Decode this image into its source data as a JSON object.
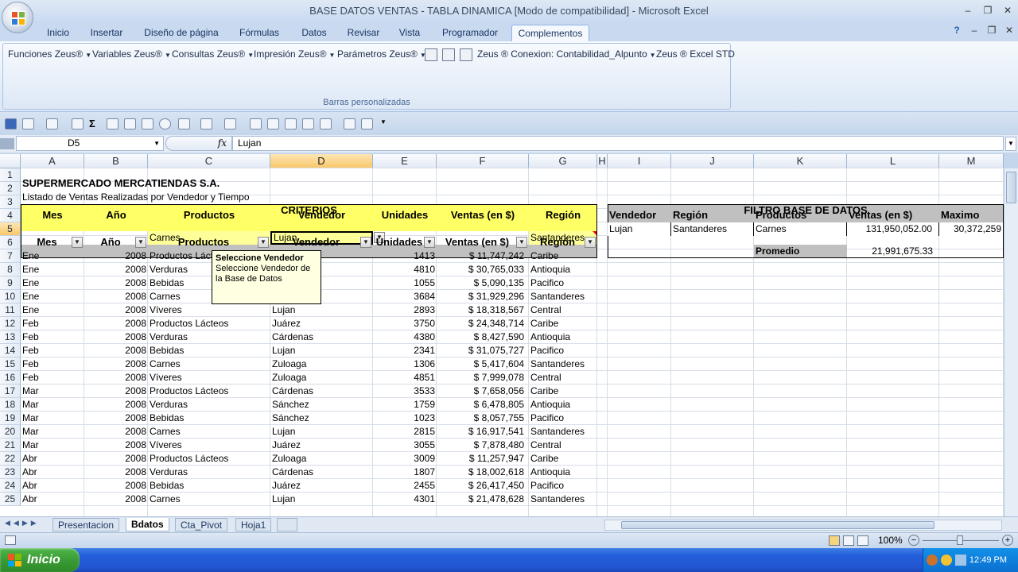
{
  "window": {
    "title": "BASE DATOS VENTAS - TABLA DINAMICA  [Modo de compatibilidad] - Microsoft Excel",
    "min": "–",
    "max": "❐",
    "close": "✕"
  },
  "tabs": [
    "Inicio",
    "Insertar",
    "Diseño de página",
    "Fórmulas",
    "Datos",
    "Revisar",
    "Vista",
    "Programador",
    "Complementos"
  ],
  "ribbon": {
    "menus": [
      "Funciones Zeus®",
      "Variables Zeus®",
      "Consultas Zeus®",
      "Impresión Zeus®",
      "Parámetros Zeus®"
    ],
    "conexion": "Zeus ® Conexion: Contabilidad_Alpunto",
    "std": "Zeus ® Excel STD",
    "group_label": "Barras personalizadas"
  },
  "formula_bar": {
    "name_box": "D5",
    "fx": "fx",
    "value": "Lujan"
  },
  "columns": [
    "A",
    "B",
    "C",
    "D",
    "E",
    "F",
    "G",
    "H",
    "I",
    "J",
    "K",
    "L",
    "M"
  ],
  "rows": [
    "1",
    "2",
    "3",
    "4",
    "5",
    "6",
    "7",
    "8",
    "9",
    "10",
    "11",
    "12",
    "13",
    "14",
    "15",
    "16",
    "17",
    "18",
    "19",
    "20",
    "21",
    "22",
    "23",
    "24",
    "25"
  ],
  "sheet": {
    "title": "SUPERMERCADO MERCATIENDAS S.A.",
    "subtitle": "Listado de Ventas Realizadas por Vendedor y Tiempo",
    "criterios": "CRITERIOS",
    "headers": [
      "Mes",
      "Año",
      "Productos",
      "Vendedor",
      "Unidades",
      "Ventas (en $)",
      "Región"
    ],
    "criteria_values": {
      "productos": "Carnes",
      "vendedor": "Lujan",
      "region": "Santanderes"
    },
    "filter_headers": [
      "Mes",
      "Año",
      "Productos",
      "Vendedor",
      "Unidades",
      "Ventas (en $)",
      "Región"
    ],
    "data": [
      [
        "Ene",
        "2008",
        "Productos Lácteos",
        "",
        "1413",
        "$ 11,747,242",
        "Caribe"
      ],
      [
        "Ene",
        "2008",
        "Verduras",
        "",
        "4810",
        "$ 30,765,033",
        "Antioquia"
      ],
      [
        "Ene",
        "2008",
        "Bebidas",
        "",
        "1055",
        "$  5,090,135",
        "Pacifico"
      ],
      [
        "Ene",
        "2008",
        "Carnes",
        "",
        "3684",
        "$ 31,929,296",
        "Santanderes"
      ],
      [
        "Ene",
        "2008",
        "Víveres",
        "Lujan",
        "2893",
        "$ 18,318,567",
        "Central"
      ],
      [
        "Feb",
        "2008",
        "Productos Lácteos",
        "Juárez",
        "3750",
        "$ 24,348,714",
        "Caribe"
      ],
      [
        "Feb",
        "2008",
        "Verduras",
        "Cárdenas",
        "4380",
        "$  8,427,590",
        "Antioquia"
      ],
      [
        "Feb",
        "2008",
        "Bebidas",
        "Lujan",
        "2341",
        "$ 31,075,727",
        "Pacifico"
      ],
      [
        "Feb",
        "2008",
        "Carnes",
        "Zuloaga",
        "1306",
        "$  5,417,604",
        "Santanderes"
      ],
      [
        "Feb",
        "2008",
        "Víveres",
        "Zuloaga",
        "4851",
        "$  7,999,078",
        "Central"
      ],
      [
        "Mar",
        "2008",
        "Productos Lácteos",
        "Cárdenas",
        "3533",
        "$  7,658,056",
        "Caribe"
      ],
      [
        "Mar",
        "2008",
        "Verduras",
        "Sánchez",
        "1759",
        "$  6,478,805",
        "Antioquia"
      ],
      [
        "Mar",
        "2008",
        "Bebidas",
        "Sánchez",
        "1023",
        "$  8,057,755",
        "Pacifico"
      ],
      [
        "Mar",
        "2008",
        "Carnes",
        "Lujan",
        "2815",
        "$ 16,917,541",
        "Santanderes"
      ],
      [
        "Mar",
        "2008",
        "Víveres",
        "Juárez",
        "3055",
        "$  7,878,480",
        "Central"
      ],
      [
        "Abr",
        "2008",
        "Productos Lácteos",
        "Zuloaga",
        "3009",
        "$ 11,257,947",
        "Caribe"
      ],
      [
        "Abr",
        "2008",
        "Verduras",
        "Cárdenas",
        "1807",
        "$ 18,002,618",
        "Antioquia"
      ],
      [
        "Abr",
        "2008",
        "Bebidas",
        "Juárez",
        "2455",
        "$ 26,417,450",
        "Pacifico"
      ],
      [
        "Abr",
        "2008",
        "Carnes",
        "Lujan",
        "4301",
        "$ 21,478,628",
        "Santanderes"
      ]
    ],
    "filtro": {
      "title": "FILTRO BASE DE DATOS",
      "headers": [
        "Vendedor",
        "Región",
        "Productos",
        "Ventas (en $)",
        "Maximo"
      ],
      "values": [
        "Lujan",
        "Santanderes",
        "Carnes",
        "131,950,052.00",
        "30,372,259"
      ],
      "promedio_label": "Promedio",
      "promedio_value": "21,991,675.33"
    }
  },
  "tooltip": {
    "title": "Seleccione Vendedor",
    "body": "Seleccione Vendedor de la Base de Datos"
  },
  "sheet_tabs": [
    "Presentacion",
    "Bdatos",
    "Cta_Pivot",
    "Hoja1"
  ],
  "status": {
    "zoom": "100%"
  },
  "taskbar": {
    "start": "Inicio",
    "time": "12:49 PM"
  }
}
